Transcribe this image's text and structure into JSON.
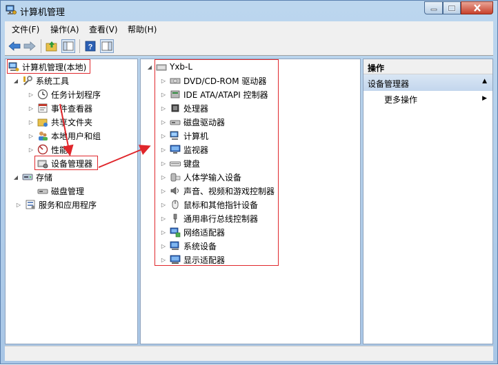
{
  "window": {
    "title": "计算机管理",
    "min_glyph": "—",
    "max_glyph": "□",
    "close_glyph": "✕"
  },
  "menu": [
    {
      "label": "文件(F)"
    },
    {
      "label": "操作(A)"
    },
    {
      "label": "查看(V)"
    },
    {
      "label": "帮助(H)"
    }
  ],
  "toolbar": {
    "back_icon": "arrow-left-icon",
    "forward_icon": "arrow-right-icon",
    "up_icon": "folder-up-icon",
    "show_hide_icon": "console-tree-icon",
    "help_icon": "help-icon",
    "action_pane_icon": "action-pane-icon"
  },
  "tree": {
    "root": "计算机管理(本地)",
    "system_tools": "系统工具",
    "task_scheduler": "任务计划程序",
    "event_viewer": "事件查看器",
    "shared_folders": "共享文件夹",
    "local_users": "本地用户和组",
    "performance": "性能",
    "device_manager": "设备管理器",
    "storage": "存储",
    "disk_management": "磁盘管理",
    "services_apps": "服务和应用程序"
  },
  "devices": {
    "computer_name": "Yxb-L",
    "items": [
      {
        "label": "DVD/CD-ROM 驱动器",
        "icon": "dvd-drive-icon"
      },
      {
        "label": "IDE ATA/ATAPI 控制器",
        "icon": "ide-controller-icon"
      },
      {
        "label": "处理器",
        "icon": "processor-icon"
      },
      {
        "label": "磁盘驱动器",
        "icon": "disk-drive-icon"
      },
      {
        "label": "计算机",
        "icon": "computer-icon"
      },
      {
        "label": "监视器",
        "icon": "monitor-icon"
      },
      {
        "label": "键盘",
        "icon": "keyboard-icon"
      },
      {
        "label": "人体学输入设备",
        "icon": "hid-icon"
      },
      {
        "label": "声音、视频和游戏控制器",
        "icon": "sound-icon"
      },
      {
        "label": "鼠标和其他指针设备",
        "icon": "mouse-icon"
      },
      {
        "label": "通用串行总线控制器",
        "icon": "usb-icon"
      },
      {
        "label": "网络适配器",
        "icon": "network-adapter-icon"
      },
      {
        "label": "系统设备",
        "icon": "system-device-icon"
      },
      {
        "label": "显示适配器",
        "icon": "display-adapter-icon"
      }
    ]
  },
  "actions": {
    "header": "操作",
    "section": "设备管理器",
    "more": "更多操作"
  },
  "colors": {
    "highlight_red": "#e0262b",
    "window_frame": "#a8c6e6"
  }
}
